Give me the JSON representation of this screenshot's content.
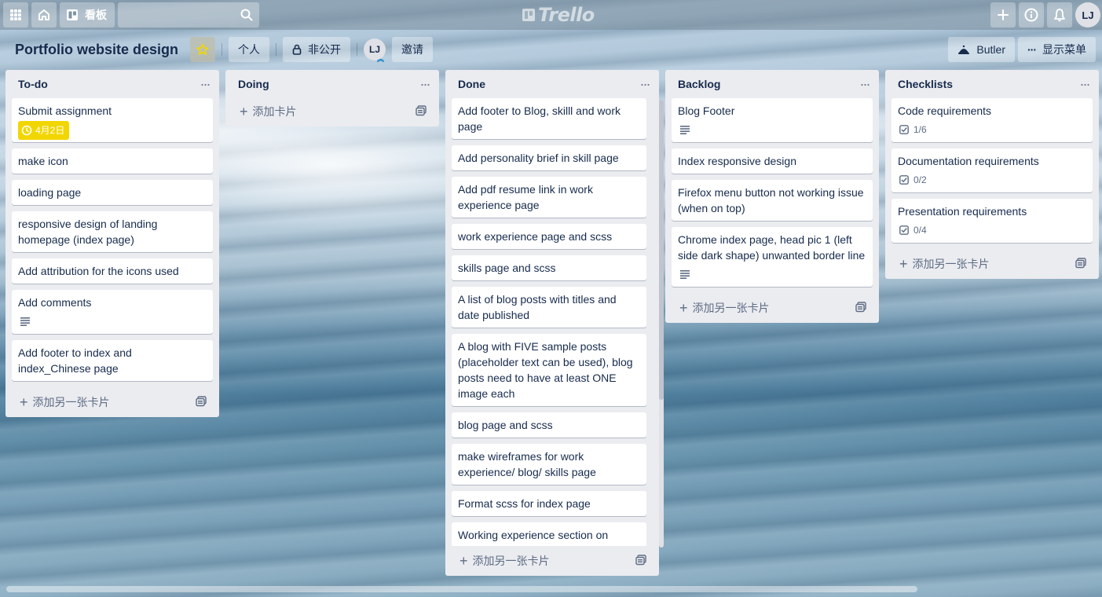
{
  "topbar": {
    "boards_label": "看板",
    "search_placeholder": "",
    "logo_text": "Trello",
    "user_initials": "LJ"
  },
  "board": {
    "title": "Portfolio website design",
    "visibility_team": "个人",
    "visibility_privacy": "非公开",
    "member_initials": "LJ",
    "invite_label": "邀请",
    "butler_label": "Butler",
    "menu_label": "显示菜单"
  },
  "lists": [
    {
      "title": "To-do",
      "cards": [
        {
          "title": "Submit assignment",
          "due": "4月2日"
        },
        {
          "title": "make icon"
        },
        {
          "title": "loading page"
        },
        {
          "title": "responsive design of landing homepage (index page)"
        },
        {
          "title": "Add attribution for the icons used"
        },
        {
          "title": "Add comments",
          "has_description": true
        },
        {
          "title": "Add footer to index and index_Chinese page"
        }
      ],
      "add_label": "添加另一张卡片"
    },
    {
      "title": "Doing",
      "cards": [],
      "add_label": "添加卡片"
    },
    {
      "title": "Done",
      "cards": [
        {
          "title": "Add footer to Blog, skilll and work page"
        },
        {
          "title": "Add personality brief in skill page"
        },
        {
          "title": "Add pdf resume link in work experience page"
        },
        {
          "title": "work experience page and scss"
        },
        {
          "title": "skills page and scss"
        },
        {
          "title": "A list of blog posts with titles and date published"
        },
        {
          "title": "A blog with FIVE sample posts (placeholder text can be used), blog posts need to have at least ONE image each"
        },
        {
          "title": "blog page and scss"
        },
        {
          "title": "make wireframes for work experience/ blog/ skills page"
        },
        {
          "title": "Format scss for index page"
        },
        {
          "title": "Working experience section on"
        }
      ],
      "add_label": "添加另一张卡片"
    },
    {
      "title": "Backlog",
      "cards": [
        {
          "title": "Blog Footer",
          "has_description": true
        },
        {
          "title": "Index responsive design"
        },
        {
          "title": "Firefox menu button not working issue (when on top)"
        },
        {
          "title": "Chrome index page, head pic 1 (left side dark shape) unwanted border line",
          "has_description": true
        }
      ],
      "add_label": "添加另一张卡片"
    },
    {
      "title": "Checklists",
      "cards": [
        {
          "title": "Code requirements",
          "checklist": "1/6"
        },
        {
          "title": "Documentation requirements",
          "checklist": "0/2"
        },
        {
          "title": "Presentation requirements",
          "checklist": "0/4"
        }
      ],
      "add_label": "添加另一张卡片"
    }
  ],
  "icons": {
    "apps": "grid-icon",
    "home": "home-icon",
    "boards": "board-icon",
    "search": "search-icon",
    "create": "plus-icon",
    "info": "info-icon",
    "notifications": "bell-icon",
    "star": "star-icon",
    "lock": "lock-icon",
    "butler": "butler-icon",
    "menu": "ellipsis-icon",
    "template": "template-icon",
    "description": "description-icon",
    "checklist": "checklist-icon",
    "clock": "clock-icon"
  },
  "colors": {
    "due_badge": "#f2d600",
    "star": "#f2d600",
    "list_bg": "#ebecf0",
    "text": "#172b4d"
  }
}
